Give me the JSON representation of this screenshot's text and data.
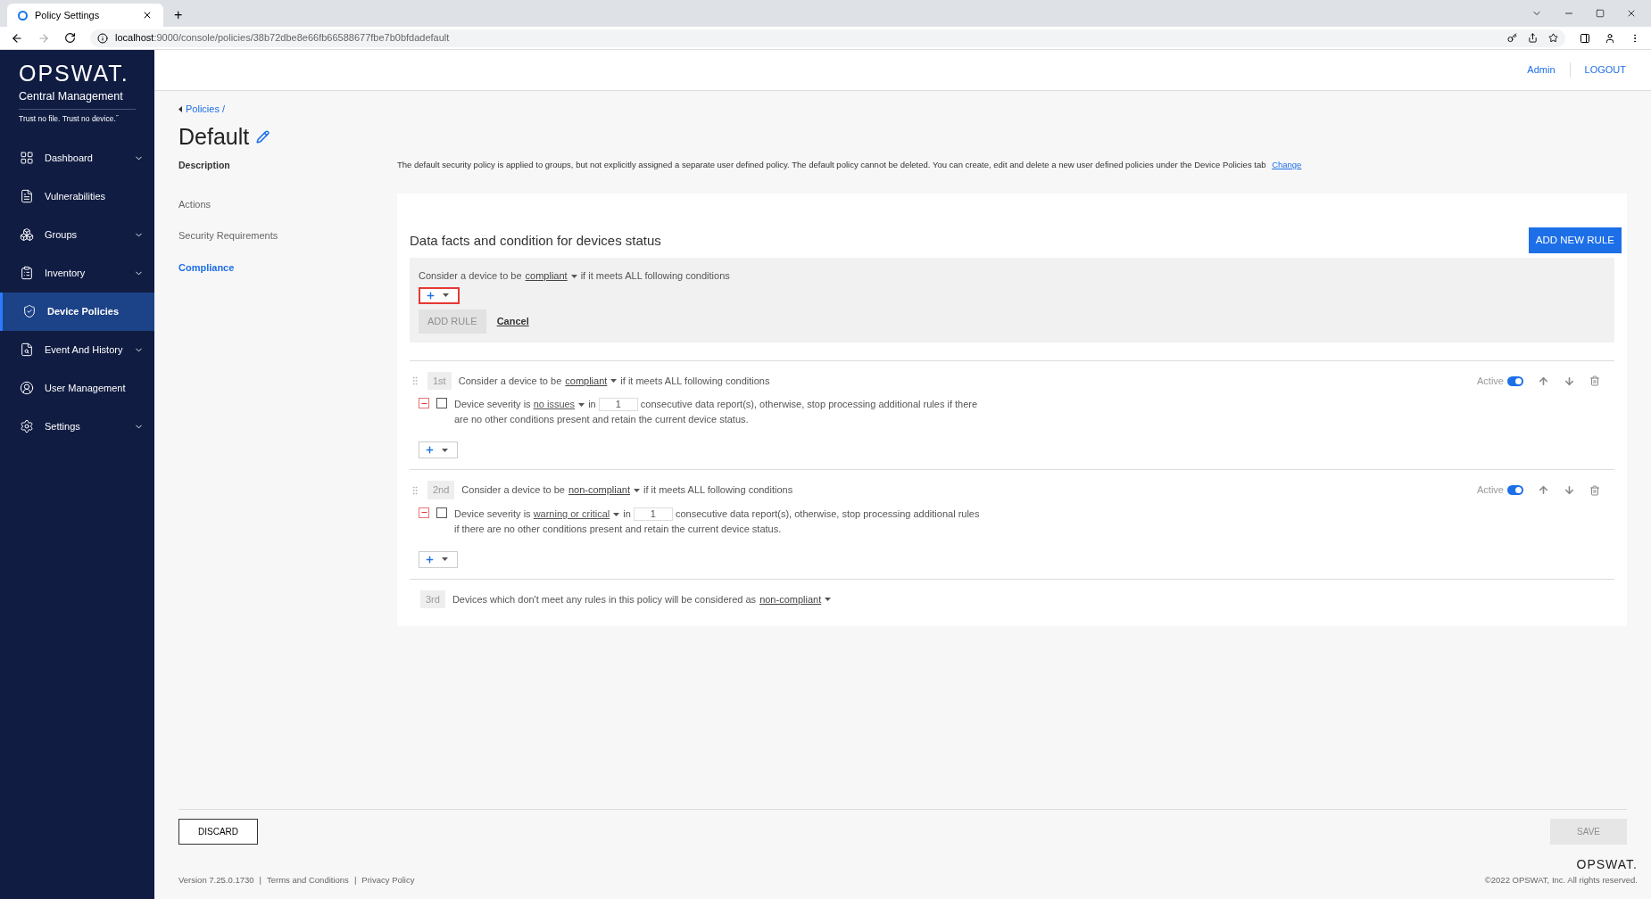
{
  "browser": {
    "tab_title": "Policy Settings",
    "new_tab": "+",
    "url_host": "localhost",
    "url_path": ":9000/console/policies/38b72dbe8e66fb66588677fbe7b0bfdadefault"
  },
  "sidebar": {
    "logo": "OPSWAT.",
    "product": "Central Management",
    "tagline": "Trust no file. Trust no device.˝",
    "items": [
      {
        "label": "Dashboard",
        "expandable": true,
        "selected": false
      },
      {
        "label": "Vulnerabilities",
        "expandable": false,
        "selected": false
      },
      {
        "label": "Groups",
        "expandable": true,
        "selected": false
      },
      {
        "label": "Inventory",
        "expandable": true,
        "selected": false
      },
      {
        "label": "Device Policies",
        "expandable": false,
        "selected": true
      },
      {
        "label": "Event And History",
        "expandable": true,
        "selected": false
      },
      {
        "label": "User Management",
        "expandable": false,
        "selected": false
      },
      {
        "label": "Settings",
        "expandable": true,
        "selected": false
      }
    ]
  },
  "header": {
    "user": "Admin",
    "logout": "LOGOUT"
  },
  "breadcrumb": "Policies /",
  "title": "Default",
  "description": {
    "label": "Description",
    "text": "The default security policy is applied to groups, but not explicitly assigned a separate user defined policy. The default policy cannot be deleted. You can create, edit and delete a new user defined policies under the Device Policies tab",
    "link": "Change"
  },
  "section_nav": [
    {
      "label": "Actions",
      "selected": false
    },
    {
      "label": "Security Requirements",
      "selected": false
    },
    {
      "label": "Compliance",
      "selected": true
    }
  ],
  "card": {
    "title": "Data facts and condition for devices status",
    "add_button": "ADD NEW RULE",
    "new_rule": {
      "prefix": "Consider a device to be",
      "status": "compliant",
      "suffix": "if it meets ALL following conditions",
      "add_highlighted": true,
      "add_rule": "ADD RULE",
      "add_rule_disabled": true,
      "cancel": "Cancel"
    },
    "rules": [
      {
        "order": "1st",
        "prefix": "Consider a device to be",
        "status": "compliant",
        "suffix": "if it meets ALL following conditions",
        "active_label": "Active",
        "active": true,
        "conditions": [
          {
            "checked": false,
            "prefix": "Device severity is",
            "value": "no issues",
            "in": "in",
            "count": "1",
            "text": "consecutive data report(s), otherwise, stop processing additional rules if there are no other conditions present and retain the current device status."
          }
        ]
      },
      {
        "order": "2nd",
        "prefix": "Consider a device to be",
        "status": "non-compliant",
        "suffix": "if it meets ALL following conditions",
        "active_label": "Active",
        "active": true,
        "conditions": [
          {
            "checked": false,
            "prefix": "Device severity is",
            "value": "warning or critical",
            "in": "in",
            "count": "1",
            "text": "consecutive data report(s), otherwise, stop processing additional rules if there are no other conditions present and retain the current device status."
          }
        ]
      }
    ],
    "default_rule": {
      "order": "3rd",
      "text": "Devices which don't meet any rules in this policy will be considered as",
      "status": "non-compliant"
    }
  },
  "footer": {
    "discard": "DISCARD",
    "save": "SAVE",
    "save_disabled": true,
    "version": "Version 7.25.0.1730",
    "separator_1": "|",
    "terms": "Terms and Conditions",
    "separator_2": "|",
    "privacy": "Privacy Policy",
    "brand": "OPSWAT.",
    "copyright": "©2022 OPSWAT, Inc. All rights reserved."
  }
}
